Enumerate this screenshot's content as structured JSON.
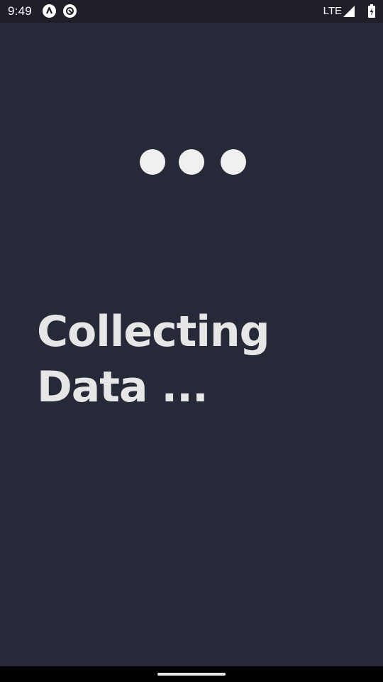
{
  "status_bar": {
    "time": "9:49",
    "network": "LTE",
    "icons": [
      "app-notification-icon",
      "sync-notification-icon",
      "signal-icon",
      "battery-charging-icon"
    ]
  },
  "loader": {
    "dots": 3,
    "color": "#f0f0f0"
  },
  "main": {
    "heading_line1": "Collecting",
    "heading_line2": "Data ..."
  },
  "colors": {
    "background": "#252938",
    "status_bar": "#1f1f29",
    "text": "#e6e6e6"
  }
}
